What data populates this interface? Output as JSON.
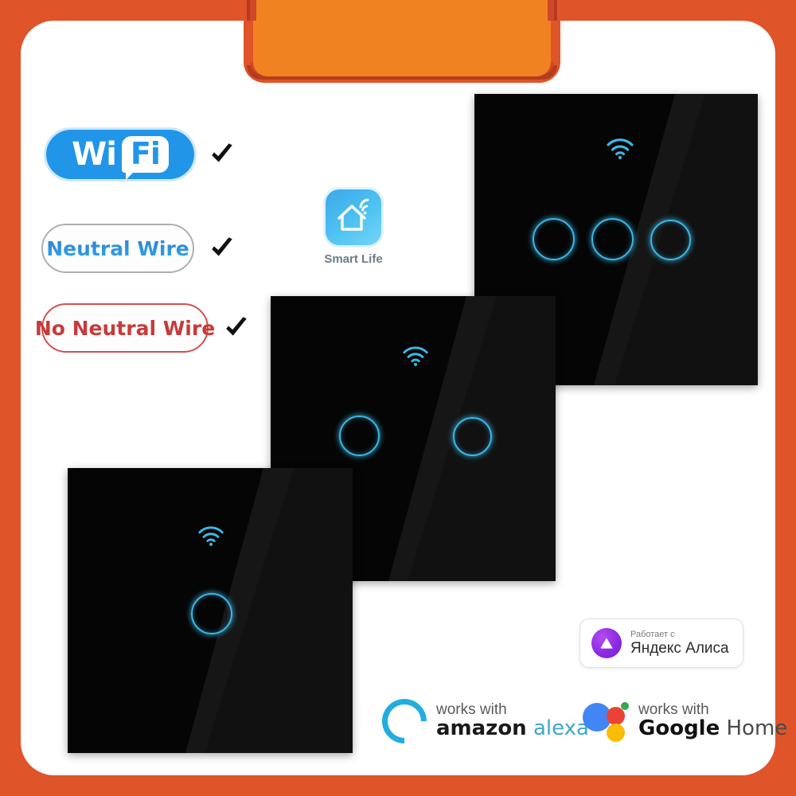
{
  "frame": {
    "border_color": "#E0542A",
    "tab_color": "#F08221",
    "tab_shadow_color": "#B73B1E",
    "card_color": "#FFFFFF"
  },
  "features": [
    {
      "id": "wifi",
      "wi": "Wi",
      "fi": "Fi",
      "checked": true,
      "color": "#2196E8"
    },
    {
      "id": "neutral-wire",
      "label": "Neutral Wire",
      "checked": true,
      "color": "#2F8FDE",
      "border": "#AFAFAF"
    },
    {
      "id": "no-neutral-wire",
      "label": "No Neutral Wire",
      "checked": true,
      "color": "#C63B3B",
      "border": "#D4504F"
    }
  ],
  "app": {
    "name": "Smart Life",
    "icon": "smart-home-wifi-icon",
    "icon_color": "#4FC3F2"
  },
  "products": [
    {
      "id": "switch-3-gang",
      "gangs": 3,
      "wifi_indicator": true,
      "panel_color": "#050505",
      "led_color": "#3BB8E8"
    },
    {
      "id": "switch-2-gang",
      "gangs": 2,
      "wifi_indicator": true,
      "panel_color": "#050505",
      "led_color": "#3BB8E8"
    },
    {
      "id": "switch-1-gang",
      "gangs": 1,
      "wifi_indicator": true,
      "panel_color": "#050505",
      "led_color": "#3BB8E8"
    }
  ],
  "assistants": {
    "yandex": {
      "small_text": "Работает с",
      "big_text": "Яндекс Алиса",
      "mark_color": "#8A2BE2"
    },
    "alexa": {
      "works_with": "works with",
      "brand": "amazon",
      "product": "alexa",
      "mark_color": "#22ADE0"
    },
    "google": {
      "works_with": "works with",
      "brand": "Google",
      "product": "Home",
      "mark_colors": [
        "#4285F4",
        "#EA4335",
        "#FBBC05",
        "#34A853"
      ]
    }
  }
}
